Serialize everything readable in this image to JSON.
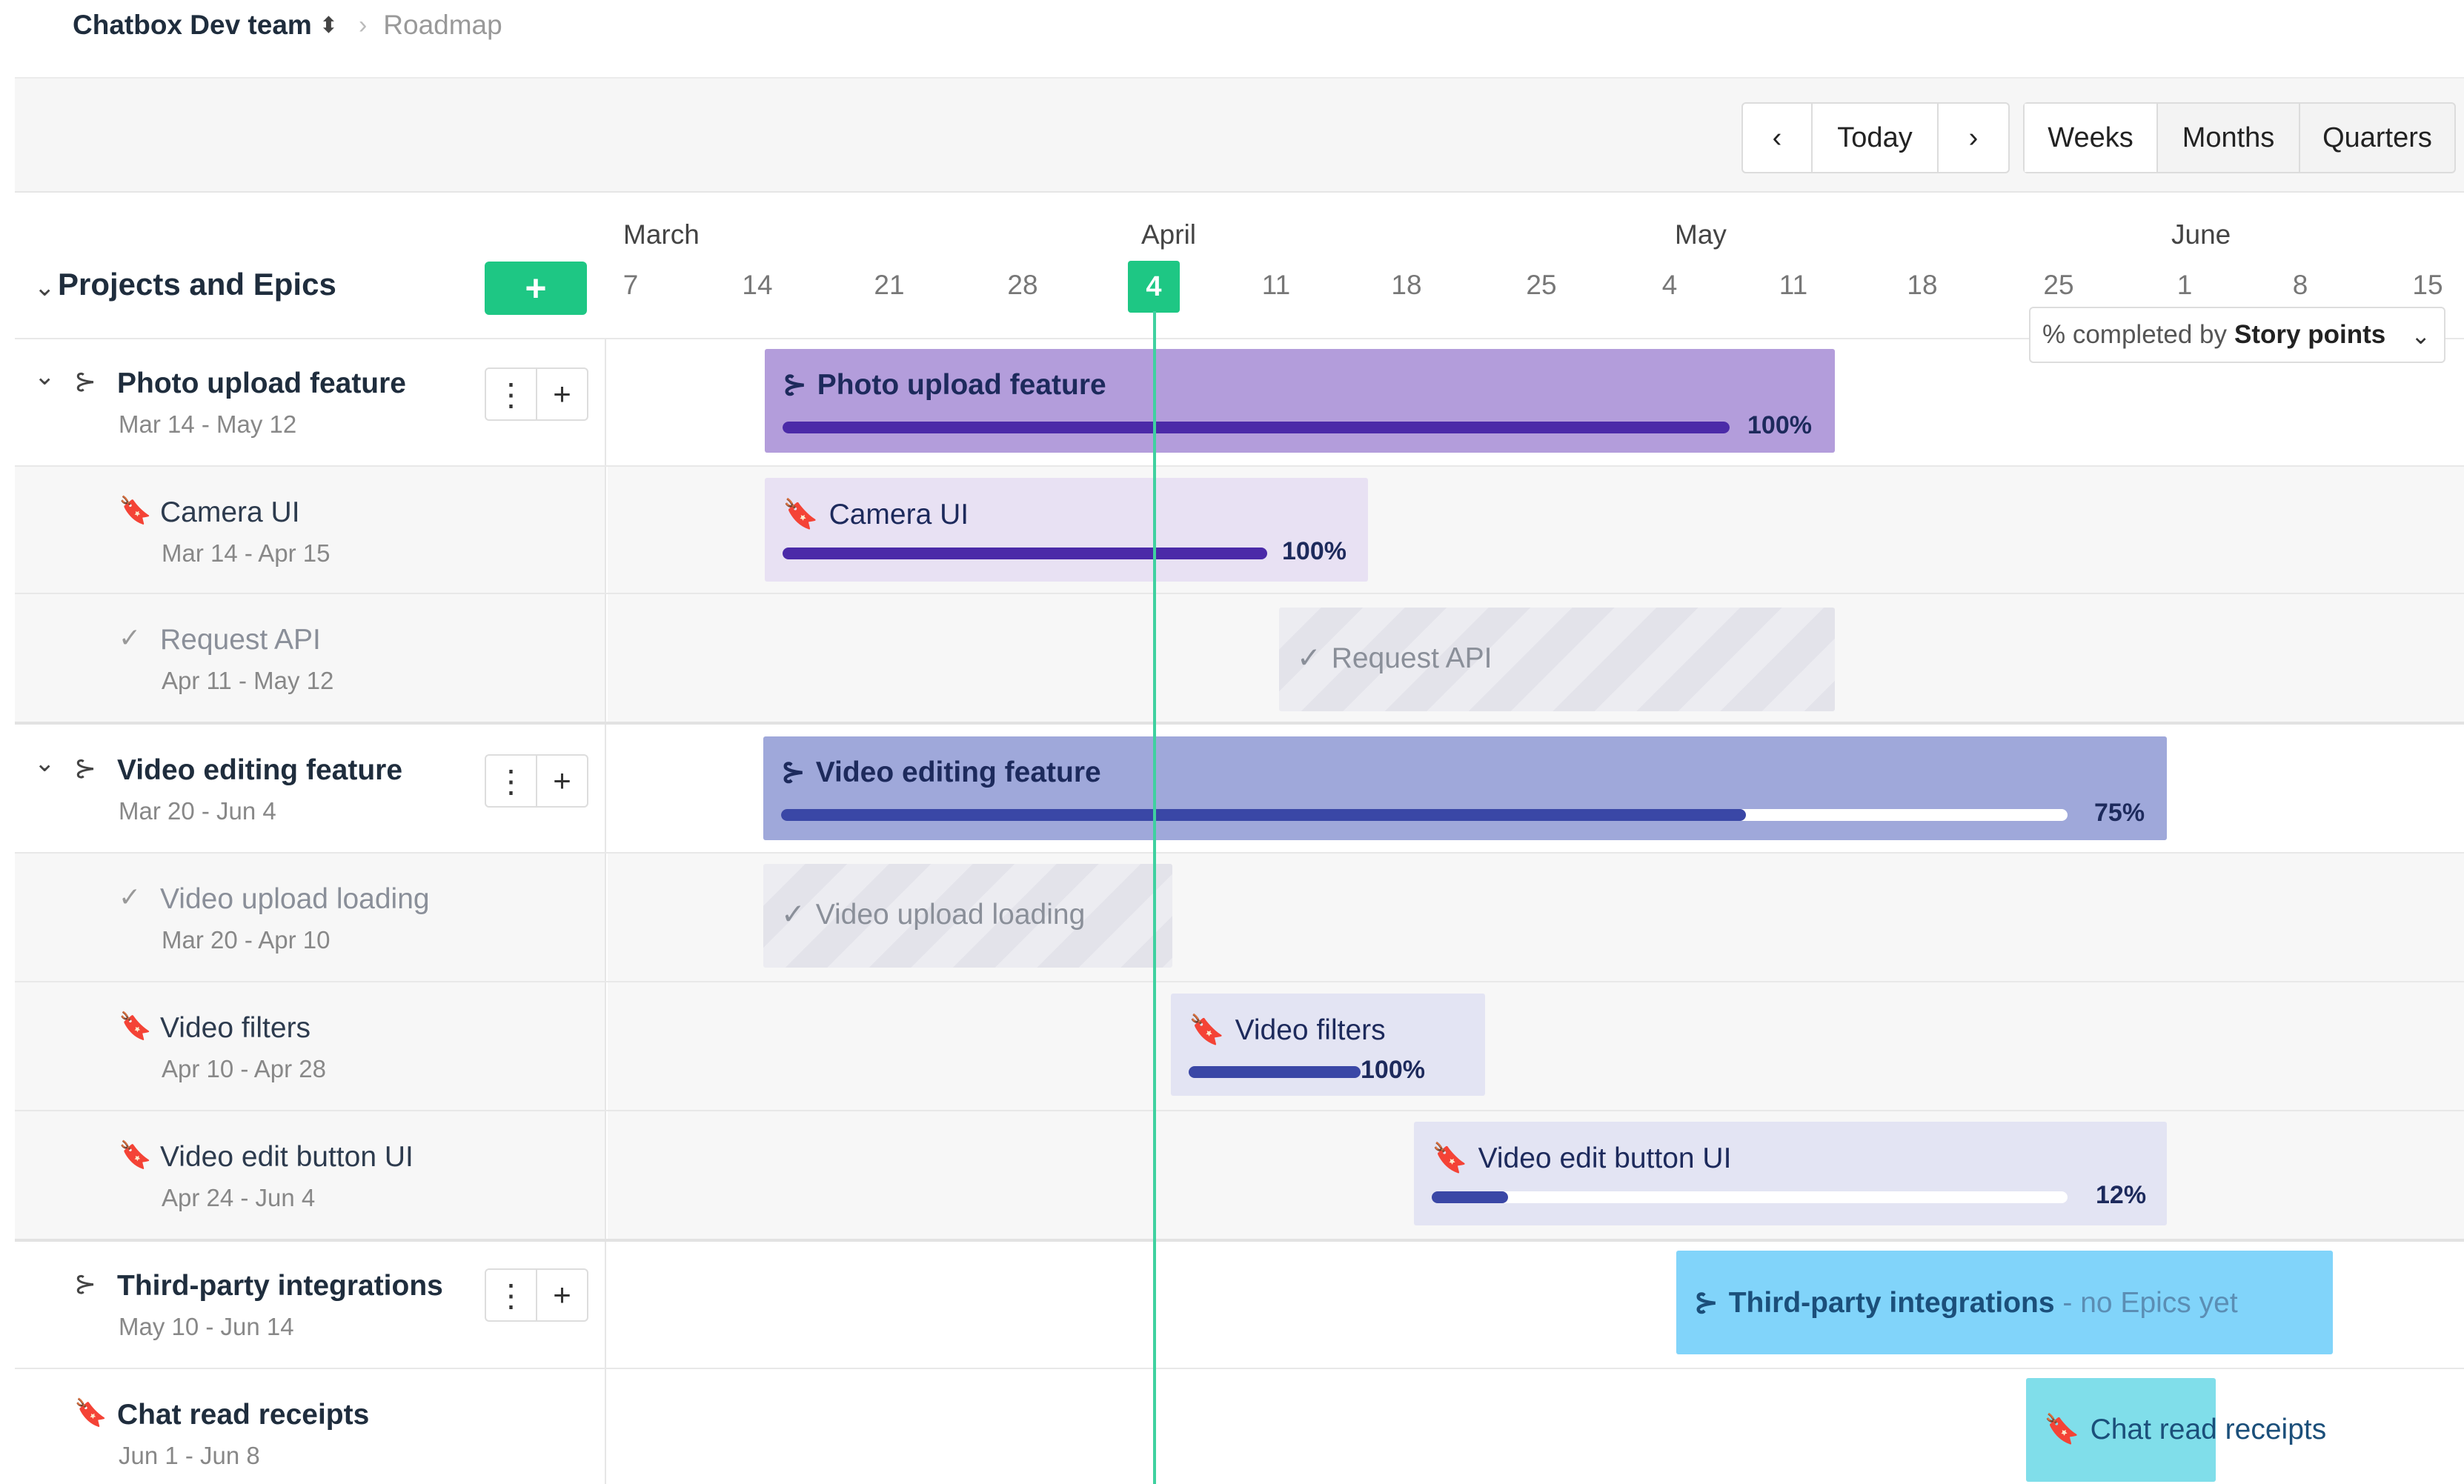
{
  "breadcrumb": {
    "team": "Chatbox Dev team",
    "sort_icon": "⬍",
    "separator": "›",
    "page": "Roadmap"
  },
  "toolbar": {
    "prev": "‹",
    "today": "Today",
    "next": "›",
    "views": {
      "weeks": "Weeks",
      "months": "Months",
      "quarters": "Quarters"
    },
    "active_view": "Weeks"
  },
  "header": {
    "chevron": "⌄",
    "title": "Projects and Epics",
    "add_label": "+"
  },
  "timeline": {
    "months": {
      "march": "March",
      "april": "April",
      "may": "May",
      "june": "June"
    },
    "days": [
      "7",
      "14",
      "21",
      "28",
      "4",
      "11",
      "18",
      "25",
      "4",
      "11",
      "18",
      "25",
      "1",
      "8",
      "15"
    ],
    "today": "4"
  },
  "progress_dropdown": {
    "prefix": "% completed by",
    "value": "Story points",
    "chevron": "⌄"
  },
  "rows": {
    "photo": {
      "title": "Photo upload feature",
      "dates": "Mar 14 - May 12",
      "bar_title": "Photo upload feature",
      "pct_text": "100%",
      "progress": 1.0
    },
    "camera": {
      "title": "Camera UI",
      "dates": "Mar 14 - Apr 15",
      "bar_title": "Camera UI",
      "pct_text": "100%",
      "progress": 1.0
    },
    "request": {
      "title": "Request API",
      "dates": "Apr 11 - May 12",
      "bar_title": "Request API"
    },
    "video": {
      "title": "Video editing feature",
      "dates": "Mar 20 - Jun 4",
      "bar_title": "Video editing feature",
      "pct_text": "75%",
      "progress": 0.75
    },
    "upload": {
      "title": "Video upload loading",
      "dates": "Mar 20 - Apr 10",
      "bar_title": "Video upload loading"
    },
    "filters": {
      "title": "Video filters",
      "dates": "Apr 10 - Apr 28",
      "bar_title": "Video filters",
      "pct_text": "100%",
      "progress": 1.0
    },
    "editbtn": {
      "title": "Video edit button UI",
      "dates": "Apr 24 - Jun 4",
      "bar_title": "Video edit button UI",
      "pct_text": "12%",
      "progress": 0.12
    },
    "thirdparty": {
      "title": "Third-party integrations",
      "dates": "May 10 - Jun 14",
      "bar_title": "Third-party integrations",
      "bar_note": "- no Epics yet"
    },
    "chat": {
      "title": "Chat read receipts",
      "dates": "Jun 1 - Jun 8",
      "bar_title": "Chat read receipts"
    }
  },
  "row_actions": {
    "more": "⋮",
    "add": "+"
  },
  "icons": {
    "project": "⊱",
    "story": "🔖",
    "task": "✓",
    "chevron": "⌄"
  },
  "colors": {
    "accent_green": "#1ec784",
    "today_line": "#3fd1a0",
    "project_purple": "#b39ddb",
    "story_light_purple": "#e8e1f3",
    "project_blue": "#9fa8da",
    "story_light_blue": "#e3e4f3",
    "project_cyan": "#81d4fa",
    "story_teal": "#80deea",
    "progress_fill": "#4b2aa8",
    "progress_fill_blue": "#3a47a6"
  }
}
